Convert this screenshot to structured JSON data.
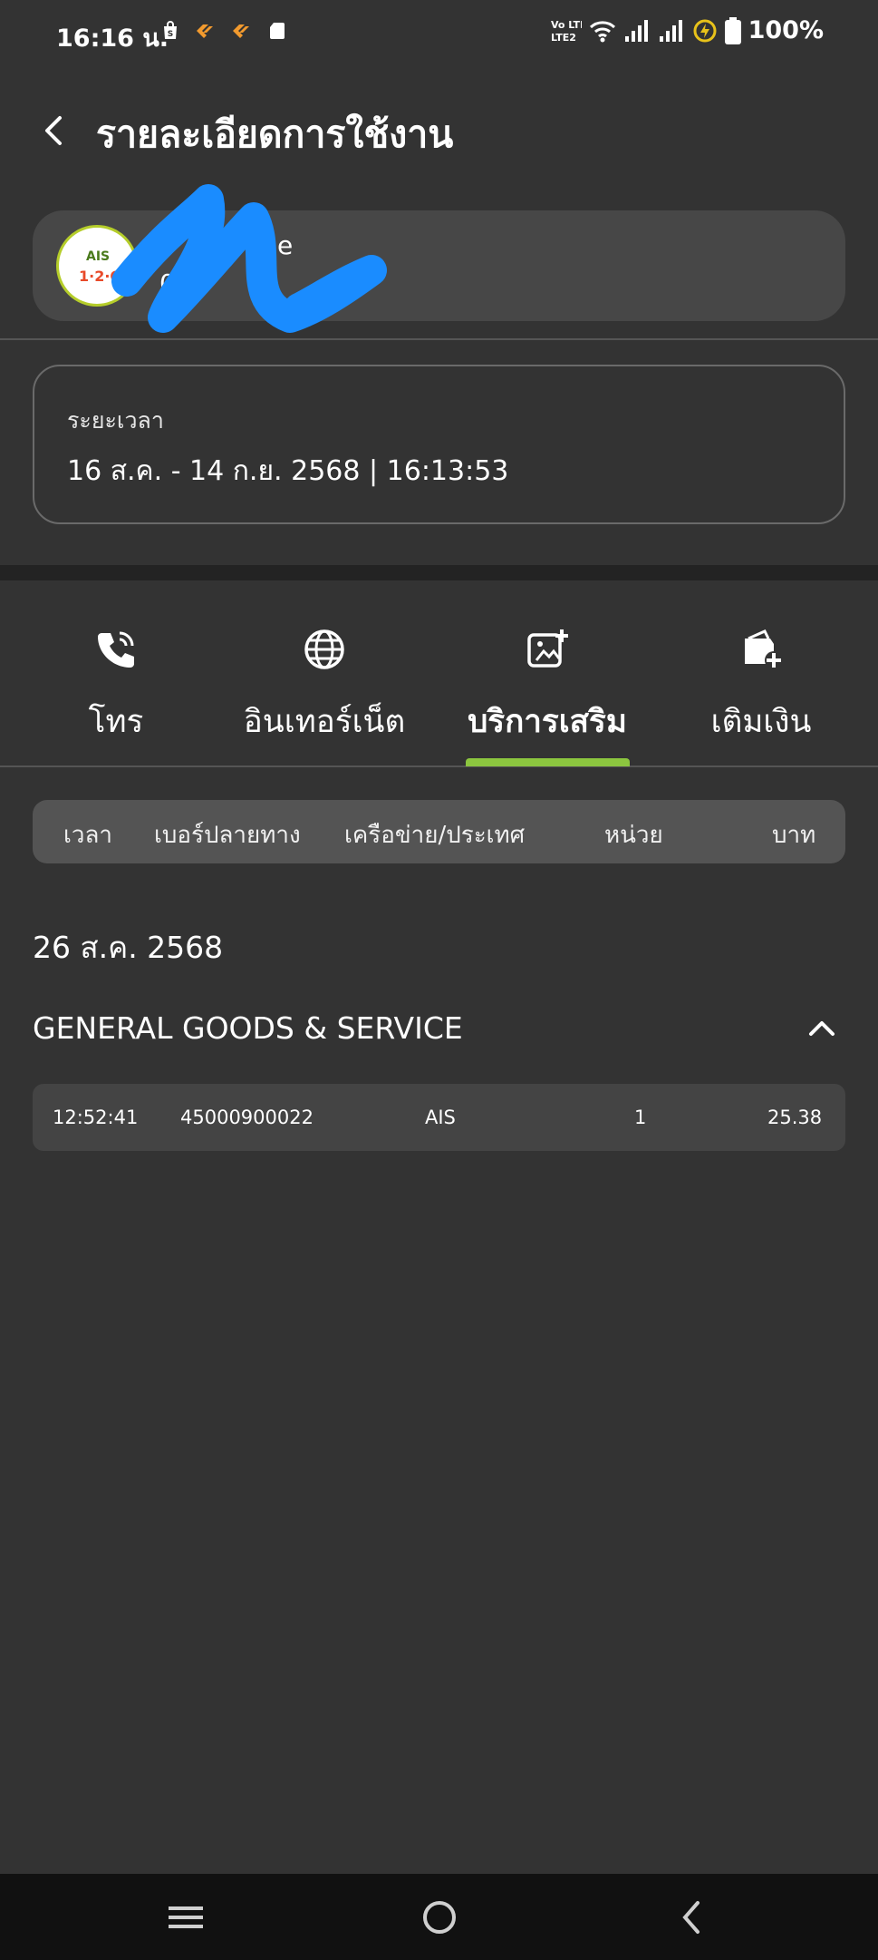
{
  "status_bar": {
    "time": "16:16 น.",
    "battery": "100%",
    "network_badge": "Vo LTE2",
    "icons": [
      "shopping-bag-icon",
      "tag-icon",
      "tag-icon",
      "sd-card-icon",
      "volte-icon",
      "wifi-icon",
      "signal-icon",
      "signal-icon",
      "data-saver-icon",
      "battery-icon"
    ]
  },
  "header": {
    "title": "รายละเอียดการใช้งาน",
    "back_icon": "chevron-left-icon"
  },
  "account": {
    "logo_text": "AIS",
    "name_partial": "e",
    "number_partial": "0  6"
  },
  "period": {
    "label": "ระยะเวลา",
    "value": "16 ส.ค. - 14 ก.ย. 2568 | 16:13:53"
  },
  "tabs": [
    {
      "label": "โทร",
      "icon": "phone-icon",
      "active": false
    },
    {
      "label": "อินเทอร์เน็ต",
      "icon": "globe-icon",
      "active": false
    },
    {
      "label": "บริการเสริม",
      "icon": "media-plus-icon",
      "active": true
    },
    {
      "label": "เติมเงิน",
      "icon": "wallet-plus-icon",
      "active": false
    }
  ],
  "columns": [
    "เวลา",
    "เบอร์ปลายทาง",
    "เครือข่าย/ประเทศ",
    "หน่วย",
    "บาท"
  ],
  "groups": [
    {
      "date": "26 ส.ค. 2568",
      "section": "GENERAL GOODS & SERVICE",
      "expanded": true,
      "rows": [
        {
          "time": "12:52:41",
          "destination": "45000900022",
          "network": "AIS",
          "unit": "1",
          "baht": "25.38"
        }
      ]
    }
  ],
  "colors": {
    "background": "#333333",
    "accent": "#8cc63f",
    "card": "#474747"
  },
  "nav_bar": [
    "menu-icon",
    "home-icon",
    "back-icon"
  ]
}
